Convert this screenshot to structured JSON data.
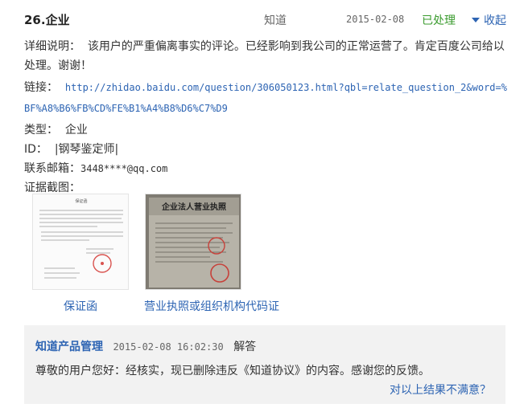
{
  "item": {
    "title": "26.企业",
    "source": "知道",
    "date": "2015-02-08",
    "status": "已处理",
    "collapse_label": "收起"
  },
  "detail": {
    "description_label": "详细说明：",
    "description": "该用户的严重偏离事实的评论。已经影响到我公司的正常运营了。肯定百度公司给以处理。谢谢！",
    "link_label": "链接：",
    "link": "http://zhidao.baidu.com/question/306050123.html?qbl=relate_question_2&word=%BF%A8%B6%FB%CD%FE%B1%A4%B8%D6%C7%D9",
    "type_label": "类型：",
    "type": "企业",
    "id_label": "ID：",
    "id": "|钢琴鉴定师|",
    "email_label": "联系邮箱：",
    "email": "3448****@qq.com",
    "evidence_label": "证据截图："
  },
  "evidence": [
    {
      "caption": "保证函",
      "image_heading": "保证函",
      "image_kind": "document-scan"
    },
    {
      "caption": "营业执照或组织机构代码证",
      "image_heading": "企业法人营业执照",
      "image_kind": "license-photo"
    }
  ],
  "reply": {
    "author": "知道产品管理",
    "time": "2015-02-08 16:02:30",
    "tag": "解答",
    "text": "尊敬的用户您好：经核实，现已删除违反《知道协议》的内容。感谢您的反馈。",
    "feedback_link": "对以上结果不满意？"
  },
  "colors": {
    "link": "#2d64b3",
    "status_done": "#3a9b2e",
    "reply_bg": "#f2f2f2",
    "stamp": "#d9534f"
  }
}
